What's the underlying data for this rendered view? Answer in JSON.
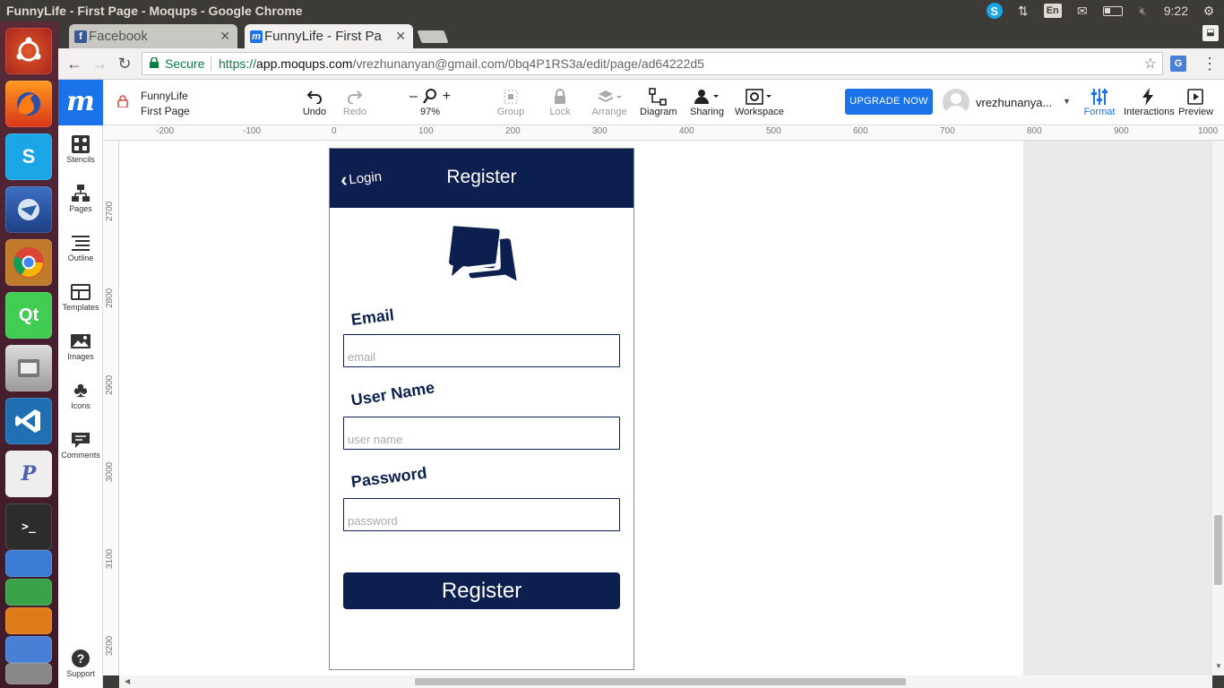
{
  "os": {
    "window_title": "FunnyLife - First Page - Moqups - Google Chrome",
    "lang": "En",
    "clock": "9:22"
  },
  "launcher": {
    "items": [
      "ubuntu-dash",
      "firefox",
      "skype-preview",
      "thunderbird",
      "chrome",
      "qt-creator",
      "files",
      "vscode",
      "phpstorm",
      "terminal",
      "libreoffice-writer",
      "libreoffice-calc",
      "libreoffice-impress",
      "software-center",
      "workspaces"
    ]
  },
  "browser": {
    "tabs": [
      {
        "label": "Facebook",
        "active": false
      },
      {
        "label": "FunnyLife - First Pa",
        "active": true
      }
    ],
    "secure_label": "Secure",
    "url_scheme": "https://",
    "url_host": "app.moqups.com",
    "url_path": "/vrezhunanyan@gmail.com/0bq4P1RS3a/edit/page/ad64222d5"
  },
  "app": {
    "project_name": "FunnyLife",
    "page_name": "First Page",
    "toolbar": {
      "undo": "Undo",
      "redo": "Redo",
      "zoom": "97%",
      "group": "Group",
      "lock": "Lock",
      "arrange": "Arrange",
      "diagram": "Diagram",
      "sharing": "Sharing",
      "workspace": "Workspace",
      "upgrade": "UPGRADE NOW",
      "username": "vrezhunanya...",
      "format": "Format",
      "interactions": "Interactions",
      "preview": "Preview"
    },
    "sidebar": {
      "stencils": "Stencils",
      "pages": "Pages",
      "outline": "Outline",
      "templates": "Templates",
      "images": "Images",
      "icons": "Icons",
      "comments": "Comments",
      "support": "Support"
    },
    "ruler_top": [
      "-200",
      "-100",
      "0",
      "100",
      "200",
      "300",
      "400",
      "500",
      "600",
      "700",
      "800",
      "900",
      "1000"
    ],
    "ruler_left": [
      "2700",
      "2800",
      "2900",
      "3000",
      "3100",
      "3200"
    ]
  },
  "mockup": {
    "back_label": "Login",
    "title": "Register",
    "email_label": "Email",
    "email_placeholder": "email",
    "username_label": "User Name",
    "username_placeholder": "user name",
    "password_label": "Password",
    "password_placeholder": "password",
    "register_button": "Register",
    "brand_color": "#0c1f4f"
  }
}
